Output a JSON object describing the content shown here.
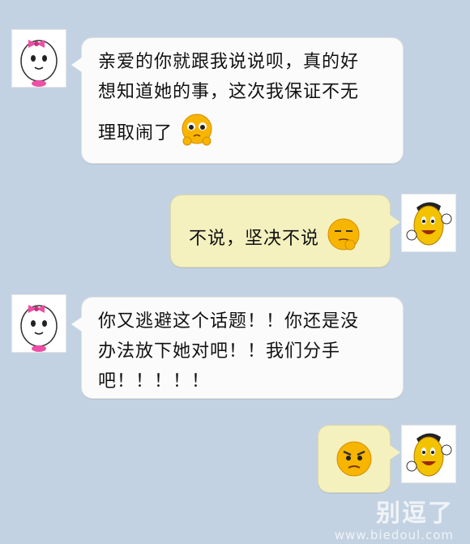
{
  "colors": {
    "background": "#c3d2e2",
    "incoming_bubble": "#fbfbfb",
    "outgoing_bubble": "#f4f1be",
    "girl_bow": "#ee4fa5",
    "boy_face": "#f3c200"
  },
  "messages": [
    {
      "sender": "girl",
      "text_lines": [
        "亲爱的你就跟我说说呗，真的好",
        "想知道她的事，这次我保证不无",
        "理取闹了"
      ],
      "emoji": "pleading-emoji"
    },
    {
      "sender": "boy",
      "text": "不说，坚决不说",
      "emoji": "smug-thinking-emoji"
    },
    {
      "sender": "girl",
      "text_lines": [
        "你又逃避这个话题！！你还是没",
        "办法放下她对吧！！我们分手",
        "吧！！！！！"
      ]
    },
    {
      "sender": "boy",
      "emoji": "angry-frown-emoji"
    }
  ],
  "watermark": {
    "title": "别逗了",
    "url": "www.biedoul.com"
  }
}
